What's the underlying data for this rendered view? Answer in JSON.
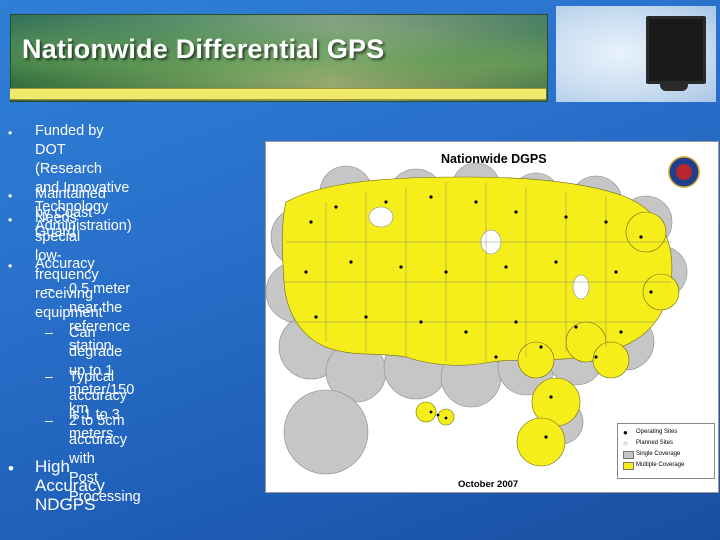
{
  "slide": {
    "title": "Nationwide Differential GPS"
  },
  "bullets": [
    {
      "level": 1,
      "lines": [
        "Funded by DOT (Research",
        "and Innovative Technology",
        "Administration)"
      ]
    },
    {
      "level": 1,
      "lines": [
        "Maintained by Coast Guard"
      ]
    },
    {
      "level": 1,
      "lines": [
        "Needs special low-frequency",
        "receiving equipment"
      ]
    },
    {
      "level": 1,
      "lines": [
        "Accuracy"
      ]
    },
    {
      "level": 2,
      "lines": [
        "0.5 meter near the",
        "reference station"
      ]
    },
    {
      "level": 2,
      "lines": [
        "Can degrade up to 1",
        "meter/150 km"
      ]
    },
    {
      "level": 2,
      "lines": [
        "Typical accuracy is 1 to 3",
        "meters"
      ]
    },
    {
      "level": 2,
      "lines": [
        "2 to 5cm accuracy with",
        "Post Processing"
      ]
    },
    {
      "level": 1,
      "lines": [
        "High Accuracy NDGPS"
      ]
    }
  ],
  "map": {
    "title": "Nationwide DGPS",
    "date": "October 2007",
    "legend": {
      "operating": "Operating Sites",
      "planned": "Planned Sites",
      "single": "Single Coverage",
      "multiple": "Multiple Coverage"
    },
    "colors": {
      "multiple_coverage": "#f5ee1a",
      "single_coverage": "#c8c8c8",
      "site": "#000000"
    }
  }
}
